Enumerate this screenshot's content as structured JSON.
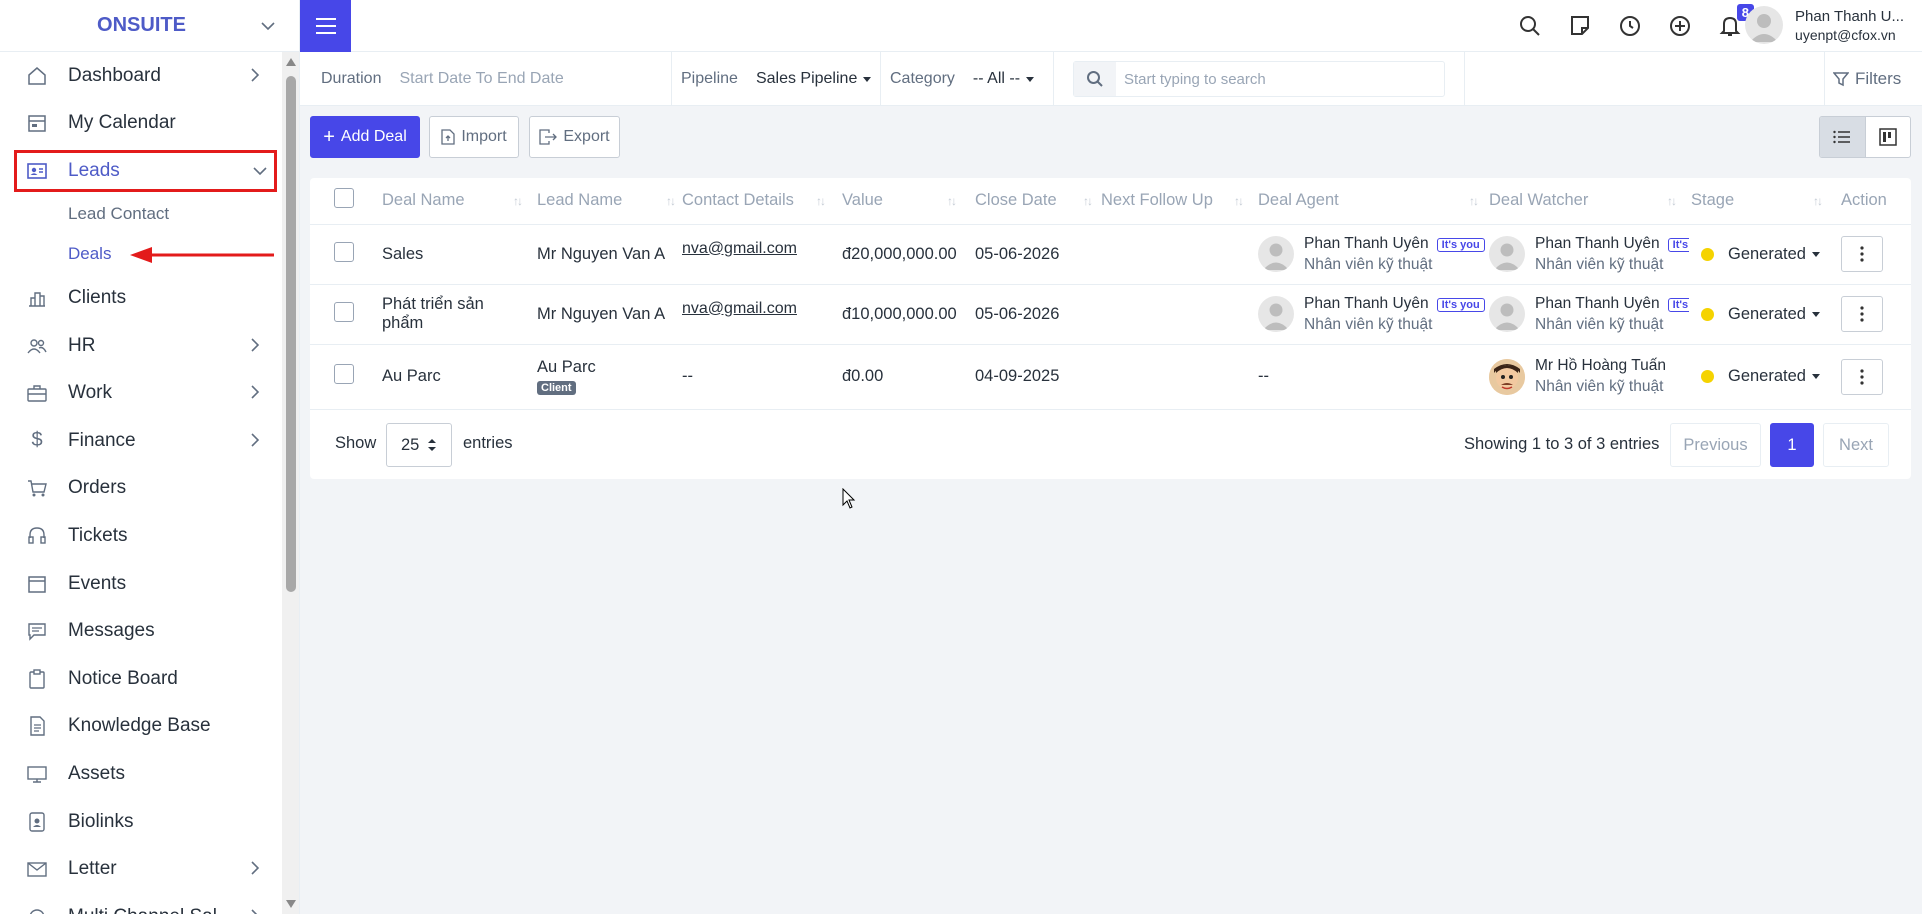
{
  "brand": {
    "name": "ONSUITE"
  },
  "sidebar": {
    "items": [
      {
        "label": "Dashboard",
        "icon": "house-icon",
        "has_arrow": true
      },
      {
        "label": "My Calendar",
        "icon": "calendar-icon",
        "has_arrow": false
      },
      {
        "label": "Leads",
        "icon": "contact-card-icon",
        "has_arrow": true,
        "expanded": true
      },
      {
        "label": "Clients",
        "icon": "building-icon",
        "has_arrow": false
      },
      {
        "label": "HR",
        "icon": "people-icon",
        "has_arrow": true
      },
      {
        "label": "Work",
        "icon": "briefcase-icon",
        "has_arrow": true
      },
      {
        "label": "Finance",
        "icon": "dollar-icon",
        "has_arrow": true
      },
      {
        "label": "Orders",
        "icon": "cart-icon",
        "has_arrow": false
      },
      {
        "label": "Tickets",
        "icon": "headset-icon",
        "has_arrow": false
      },
      {
        "label": "Events",
        "icon": "calendar-event-icon",
        "has_arrow": false
      },
      {
        "label": "Messages",
        "icon": "chat-icon",
        "has_arrow": false
      },
      {
        "label": "Notice Board",
        "icon": "clipboard-icon",
        "has_arrow": false
      },
      {
        "label": "Knowledge Base",
        "icon": "document-icon",
        "has_arrow": false
      },
      {
        "label": "Assets",
        "icon": "monitor-icon",
        "has_arrow": false
      },
      {
        "label": "Biolinks",
        "icon": "id-badge-icon",
        "has_arrow": false
      },
      {
        "label": "Letter",
        "icon": "envelope-icon",
        "has_arrow": true
      },
      {
        "label": "Multi Channel Sal...",
        "icon": "channel-icon",
        "has_arrow": true
      }
    ],
    "leads_sub": [
      "Lead Contact",
      "Deals"
    ]
  },
  "header": {
    "notification_count": "8",
    "user_name": "Phan Thanh U...",
    "user_email": "uyenpt@cfox.vn"
  },
  "filters": {
    "duration_label": "Duration",
    "duration_value": "Start Date To End Date",
    "pipeline_label": "Pipeline",
    "pipeline_value": "Sales Pipeline",
    "category_label": "Category",
    "category_value": "-- All --",
    "search_placeholder": "Start typing to search",
    "filters_label": "Filters"
  },
  "actions": {
    "add": "Add Deal",
    "import": "Import",
    "export": "Export"
  },
  "table": {
    "headers": [
      "Deal Name",
      "Lead Name",
      "Contact Details",
      "Value",
      "Close Date",
      "Next Follow Up",
      "Deal Agent",
      "Deal Watcher",
      "Stage",
      "Action"
    ],
    "you_tag": "It's you",
    "client_tag": "Client",
    "rows": [
      {
        "deal": "Sales",
        "lead": "Mr Nguyen Van A",
        "contact": "nva@gmail.com",
        "value": "đ20,000,000.00",
        "close": "05-06-2026",
        "followup": "",
        "agent_name": "Phan Thanh Uyên",
        "agent_role": "Nhân viên kỹ thuật",
        "watcher_name": "Phan Thanh Uyên",
        "watcher_role": "Nhân viên kỹ thuật",
        "stage": "Generated"
      },
      {
        "deal": "Phát triển sản phẩm",
        "lead": "Mr Nguyen Van A",
        "contact": "nva@gmail.com",
        "value": "đ10,000,000.00",
        "close": "05-06-2026",
        "followup": "",
        "agent_name": "Phan Thanh Uyên",
        "agent_role": "Nhân viên kỹ thuật",
        "watcher_name": "Phan Thanh Uyên",
        "watcher_role": "Nhân viên kỹ thuật",
        "stage": "Generated"
      },
      {
        "deal": "Au Parc",
        "lead": "Au Parc",
        "contact": "--",
        "value": "đ0.00",
        "close": "04-09-2025",
        "followup": "",
        "agent_name": "--",
        "agent_role": "",
        "watcher_name": "Mr Hồ Hoàng Tuấn",
        "watcher_role": "Nhân viên kỹ thuật",
        "stage": "Generated"
      }
    ]
  },
  "pagination": {
    "show": "Show",
    "page_size": "25",
    "entries": "entries",
    "summary": "Showing 1 to 3 of 3 entries",
    "previous": "Previous",
    "current": "1",
    "next": "Next"
  },
  "colors": {
    "primary": "#4747e8",
    "highlight": "#e31b1b",
    "stage_dot": "#f5d300"
  }
}
